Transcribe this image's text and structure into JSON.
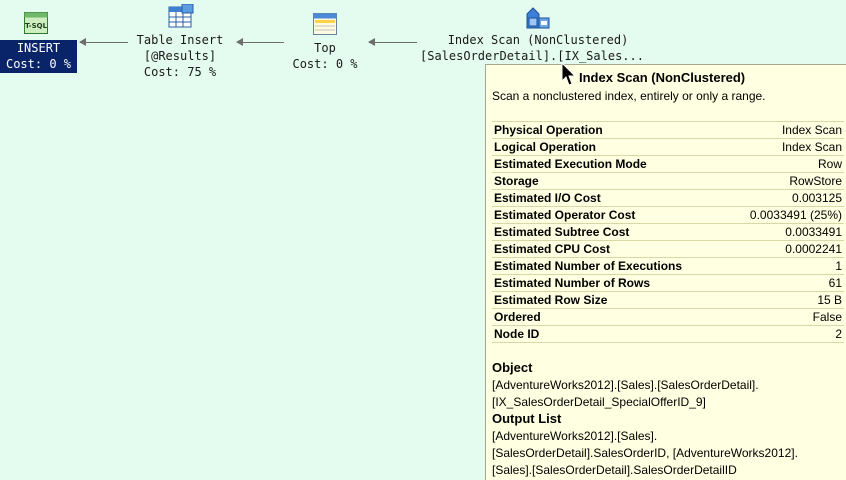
{
  "plan": {
    "insert": {
      "label": "INSERT",
      "cost": "Cost: 0 %",
      "icon": "tsql-icon",
      "icon_text": "T-SQL"
    },
    "table_insert": {
      "label": "Table Insert",
      "target": "[@Results]",
      "cost": "Cost: 75 %",
      "icon": "table-insert-icon"
    },
    "top": {
      "label": "Top",
      "cost": "Cost: 0 %",
      "icon": "top-icon"
    },
    "index_scan": {
      "label": "Index Scan (NonClustered)",
      "object": "[SalesOrderDetail].[IX_Sales...",
      "icon": "index-scan-icon"
    }
  },
  "tooltip": {
    "title": "Index Scan (NonClustered)",
    "description": "Scan a nonclustered index, entirely or only a range.",
    "properties": [
      {
        "key": "Physical Operation",
        "value": "Index Scan"
      },
      {
        "key": "Logical Operation",
        "value": "Index Scan"
      },
      {
        "key": "Estimated Execution Mode",
        "value": "Row"
      },
      {
        "key": "Storage",
        "value": "RowStore"
      },
      {
        "key": "Estimated I/O Cost",
        "value": "0.003125"
      },
      {
        "key": "Estimated Operator Cost",
        "value": "0.0033491 (25%)"
      },
      {
        "key": "Estimated Subtree Cost",
        "value": "0.0033491"
      },
      {
        "key": "Estimated CPU Cost",
        "value": "0.0002241"
      },
      {
        "key": "Estimated Number of Executions",
        "value": "1"
      },
      {
        "key": "Estimated Number of Rows",
        "value": "61"
      },
      {
        "key": "Estimated Row Size",
        "value": "15 B"
      },
      {
        "key": "Ordered",
        "value": "False"
      },
      {
        "key": "Node ID",
        "value": "2"
      }
    ],
    "object_heading": "Object",
    "object_lines": [
      "[AdventureWorks2012].[Sales].[SalesOrderDetail].",
      "[IX_SalesOrderDetail_SpecialOfferID_9]"
    ],
    "output_heading": "Output List",
    "output_lines": [
      "[AdventureWorks2012].[Sales].",
      "[SalesOrderDetail].SalesOrderID, [AdventureWorks2012].",
      "[Sales].[SalesOrderDetail].SalesOrderDetailID"
    ]
  },
  "colors": {
    "canvas": "#e4fbf0",
    "tooltip_bg": "#ffffe1",
    "selected_node": "#0a246a"
  }
}
